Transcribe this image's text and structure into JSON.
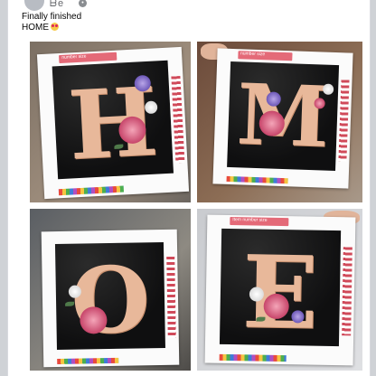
{
  "post": {
    "author_name": "ᗷe",
    "text_line1": "Finally finished",
    "text_line2": "HOME",
    "emoji": "heart-eyes-emoji"
  },
  "photos": [
    {
      "letter": "H",
      "label": "number size"
    },
    {
      "letter": "M",
      "label": "number size"
    },
    {
      "letter": "O",
      "label": ""
    },
    {
      "letter": "E",
      "label": "Item number size"
    }
  ],
  "colors": {
    "accent_label": "#e46a78",
    "letter_gold": "#e8b89a",
    "canvas_black": "#111111"
  }
}
